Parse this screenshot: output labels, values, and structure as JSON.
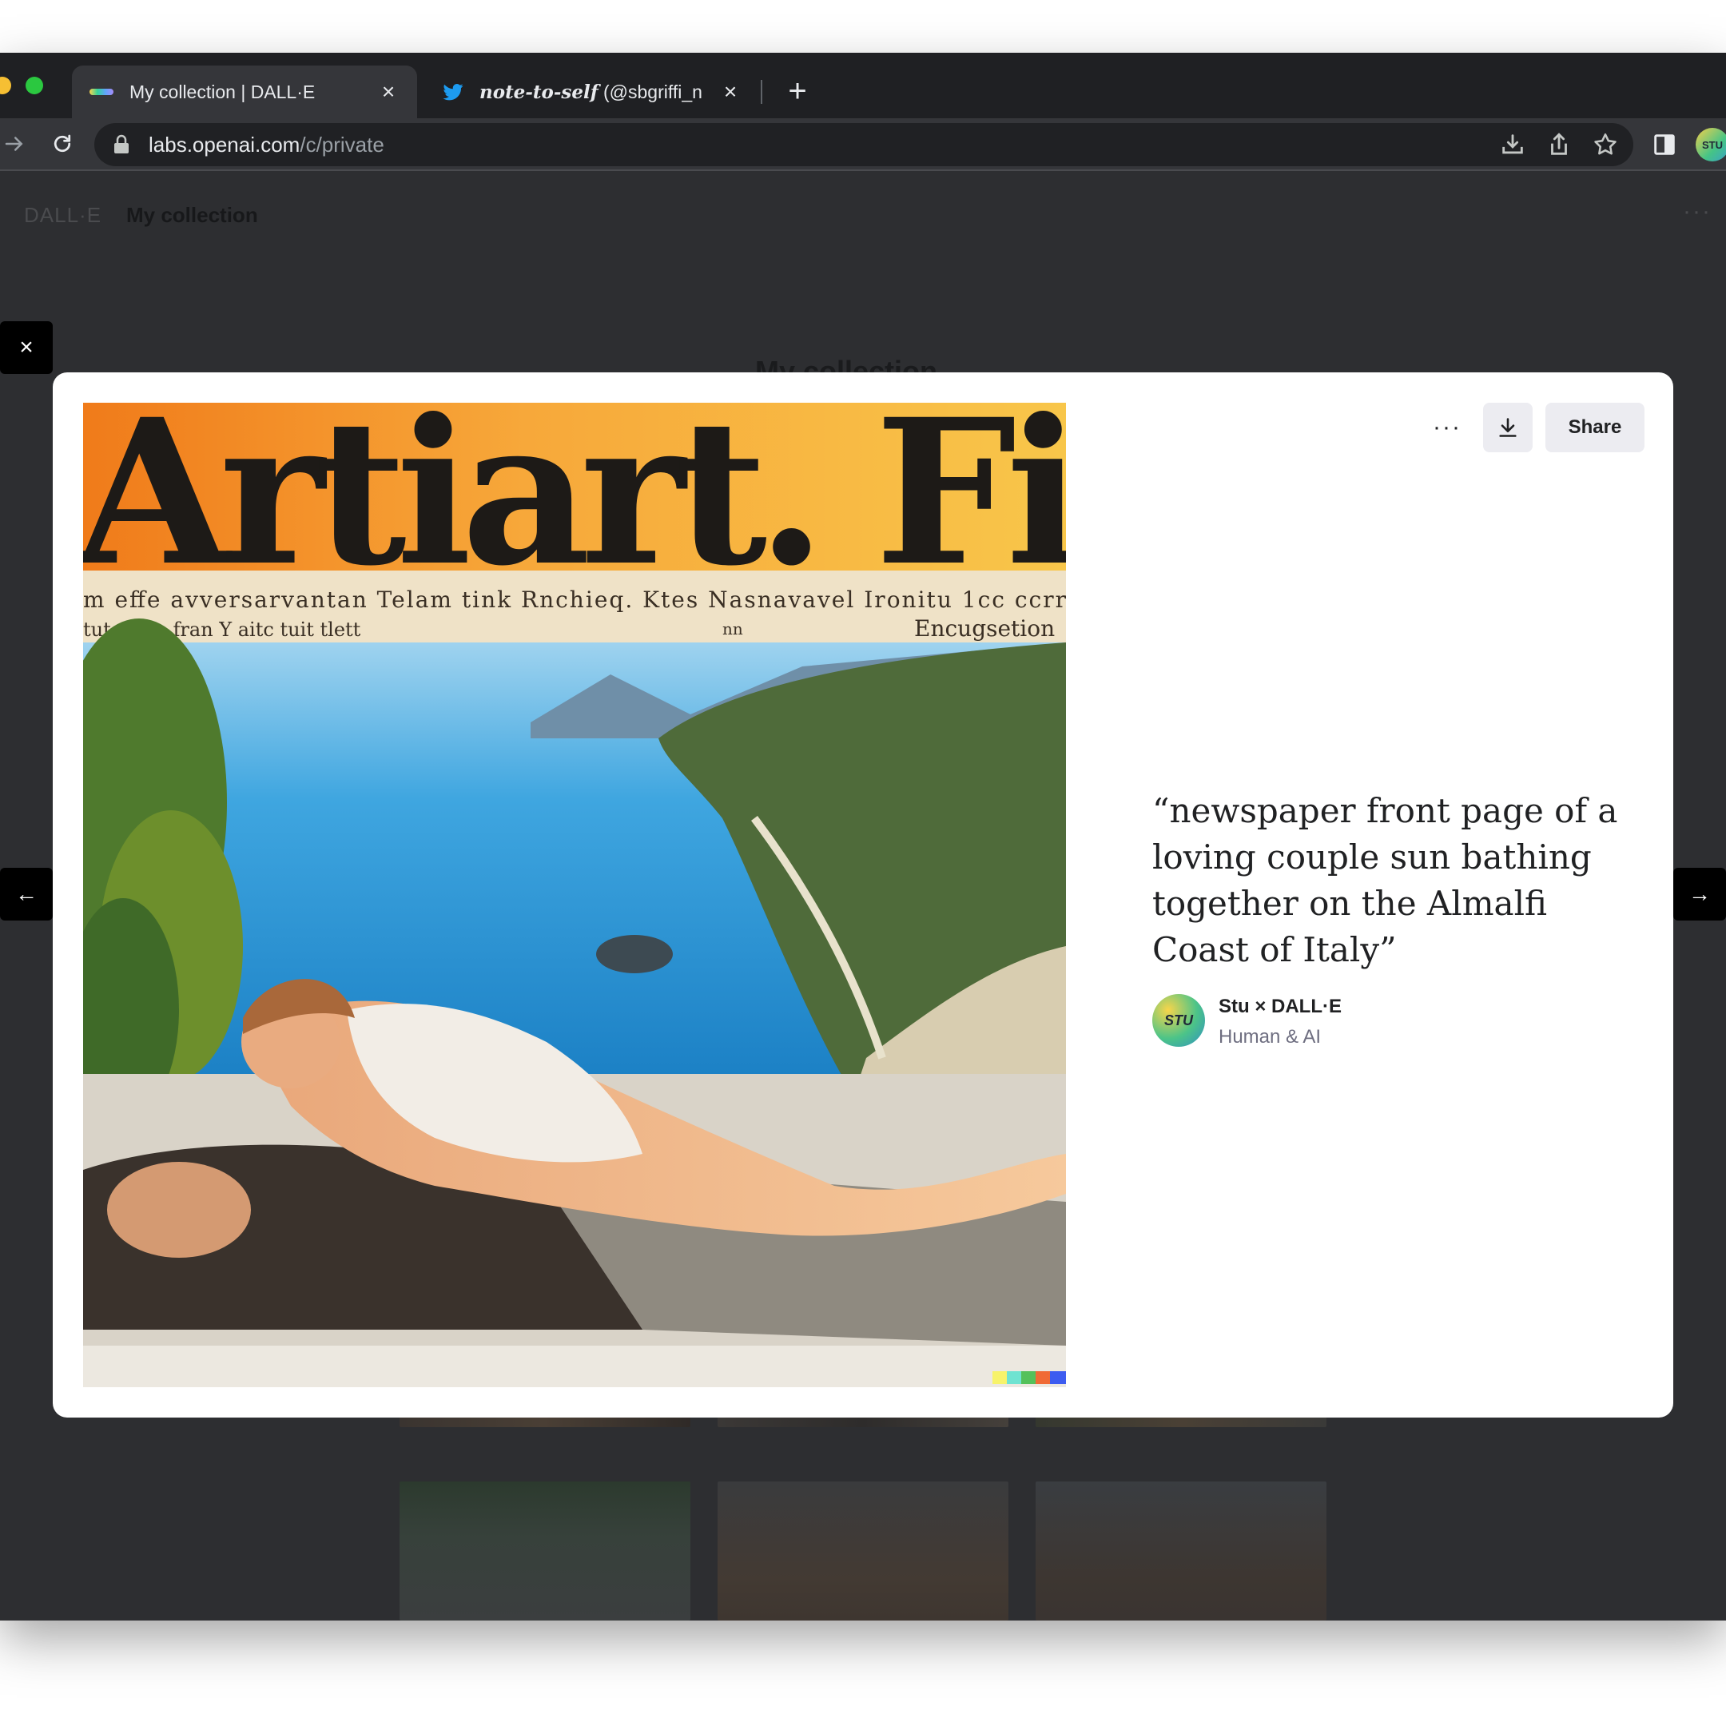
{
  "browser": {
    "tabs": [
      {
        "title": "My collection | DALL·E",
        "active": true
      },
      {
        "title_styled": "note-to-self",
        "title_rest": " (@sbgriffi_n",
        "active": false
      }
    ],
    "new_tab_label": "+",
    "close_glyph": "×",
    "url_host": "labs.openai.com",
    "url_path": "/c/private",
    "profile_initials": "STU"
  },
  "app": {
    "brand": "DALL·E",
    "breadcrumb": "My collection",
    "more_label": "···",
    "heading": "My collection"
  },
  "modal": {
    "close_glyph": "×",
    "prev_glyph": "←",
    "next_glyph": "→",
    "more_label": "···",
    "share_label": "Share",
    "prompt": "“newspaper front page of a loving couple sun bathing together on the Almalfi Coast of Italy”",
    "credit_name": "Stu × DALL·E",
    "credit_sub": "Human & AI",
    "credit_initials": "STU"
  },
  "image": {
    "headline": "Artiart. Fi",
    "subline_1": "m effe avversarvantan Telam tink Rnchieq. Ktes Nasnavavel Ironitu 1cc ccrr",
    "subline_2": "tutor  vip fran Y aitc tuit tlett",
    "subline_3": "nn",
    "subline_4": "Encugsetion"
  },
  "colors": {
    "accent_black": "#000000",
    "chrome_dark": "#1f2023",
    "chrome_toolbar": "#35363a",
    "page_dim": "#2d2e31",
    "button_gray": "#ececf1",
    "text_primary": "#202123",
    "text_secondary": "#6e6e80"
  }
}
